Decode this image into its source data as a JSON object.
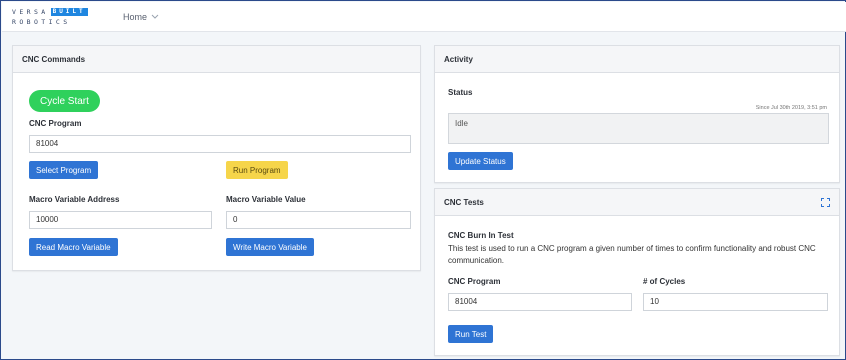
{
  "nav": {
    "logo_top": "VERSA",
    "logo_badge": "BUILT",
    "logo_bottom": "ROBOTICS",
    "home_label": "Home"
  },
  "cnc_commands": {
    "title": "CNC Commands",
    "cycle_start_label": "Cycle Start",
    "program_label": "CNC Program",
    "program_value": "81004",
    "select_program_label": "Select Program",
    "run_program_label": "Run Program",
    "macro_address_label": "Macro Variable Address",
    "macro_address_value": "10000",
    "macro_value_label": "Macro Variable Value",
    "macro_value_value": "0",
    "read_macro_label": "Read Macro Variable",
    "write_macro_label": "Write Macro Variable"
  },
  "activity": {
    "title": "Activity",
    "status_label": "Status",
    "since_text": "Since Jul 30th 2019, 3:51 pm",
    "status_value": "Idle",
    "update_status_label": "Update Status"
  },
  "cnc_tests": {
    "title": "CNC Tests",
    "burn_in_title": "CNC Burn In Test",
    "burn_in_desc": "This test is used to run a CNC program a given number of times to confirm functionality and robust CNC communication.",
    "program_label": "CNC Program",
    "program_value": "81004",
    "cycles_label": "# of Cycles",
    "cycles_value": "10",
    "run_test_label": "Run Test"
  },
  "colors": {
    "primary": "#2f74d4",
    "success": "#2fd15c",
    "warning": "#f6d54a",
    "brand": "#1f86e0"
  },
  "icons": {
    "home_chevron": "chevron-down-icon",
    "tests_expand": "expand-icon"
  }
}
